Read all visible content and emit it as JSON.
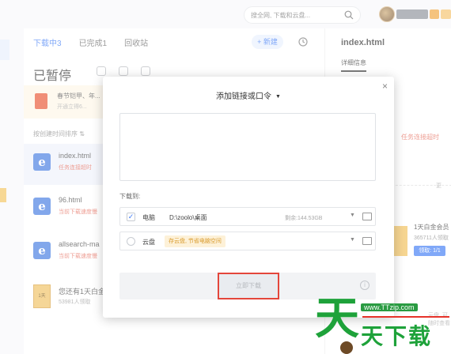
{
  "topbar": {
    "search_placeholder": "搜全网, 下载和云盘..."
  },
  "list": {
    "tabs": [
      {
        "label": "下载中3"
      },
      {
        "label": "已完成1"
      },
      {
        "label": "回收站"
      }
    ],
    "new_button": "+ 新建",
    "section_title": "已暂停",
    "promo": {
      "title": "春节铠甲、年...",
      "subtitle": "开通立得6..."
    },
    "sort_label": "按创建时间排序 ⇅",
    "rows": [
      {
        "name": "index.html",
        "status": "任务连接超时"
      },
      {
        "name": "96.html",
        "status": "当前下载速度慢"
      },
      {
        "name": "allsearch-ma",
        "status": "当前下载速度慢"
      },
      {
        "name": "您还有1天白金",
        "status": "53981人领取",
        "book": "1天"
      }
    ]
  },
  "detail": {
    "file_name": "index.html",
    "tab_label": "详细信息",
    "error_text": "任务连接超时",
    "dash_label": "更",
    "card": {
      "title": "1天白金会员",
      "count": "365711人领取",
      "claim": "领取: 1/1"
    },
    "tip": "云盘, 可随时查看"
  },
  "modal": {
    "close": "×",
    "title": "添加链接或口令",
    "caret": "▼",
    "textarea_value": "",
    "download_to_label": "下载到:",
    "pc_option": {
      "label": "电脑",
      "path": "D:\\zoolo\\桌面",
      "space": "剩余:144.53GB",
      "checked": "✓"
    },
    "cloud_option": {
      "label": "云盘",
      "hint": "存云盘, 节省电脑空间"
    },
    "download_button": "立即下载",
    "info_icon": "i"
  },
  "watermark": {
    "big_char": "天",
    "url": "www.TTzip.com",
    "chars": "天下载"
  },
  "colors": {
    "accent": "#3d7af5",
    "error": "#e56a5a",
    "highlight_border": "#e4463b",
    "watermark_green": "#1ea23a"
  }
}
